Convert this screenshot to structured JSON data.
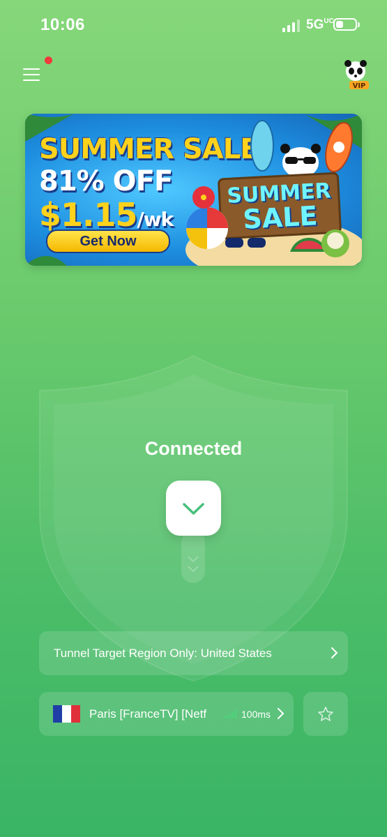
{
  "status_bar": {
    "time": "10:06",
    "network": "5G",
    "network_sup": "UC"
  },
  "header": {
    "menu_icon": "hamburger-menu-icon",
    "notification_dot_color": "#ef3b3b",
    "vip_badge": "VIP"
  },
  "banner": {
    "line1": "SUMMER SALE",
    "line2": "81% OFF",
    "price": "$1.15",
    "price_unit": "/wk",
    "cta": "Get Now",
    "sign_line1": "SUMMER",
    "sign_line2": "SALE"
  },
  "connection": {
    "status": "Connected",
    "toggle_icon": "chevron-down-icon"
  },
  "region": {
    "label": "Tunnel Target Region Only: United States"
  },
  "server": {
    "flag": "france-flag-icon",
    "name": "Paris [FranceTV] [Netf",
    "ping": "100ms"
  },
  "favorite": {
    "icon": "star-icon"
  },
  "colors": {
    "bg_top": "#86d77a",
    "bg_bottom": "#39b465",
    "accent_green": "#4cc46f"
  }
}
